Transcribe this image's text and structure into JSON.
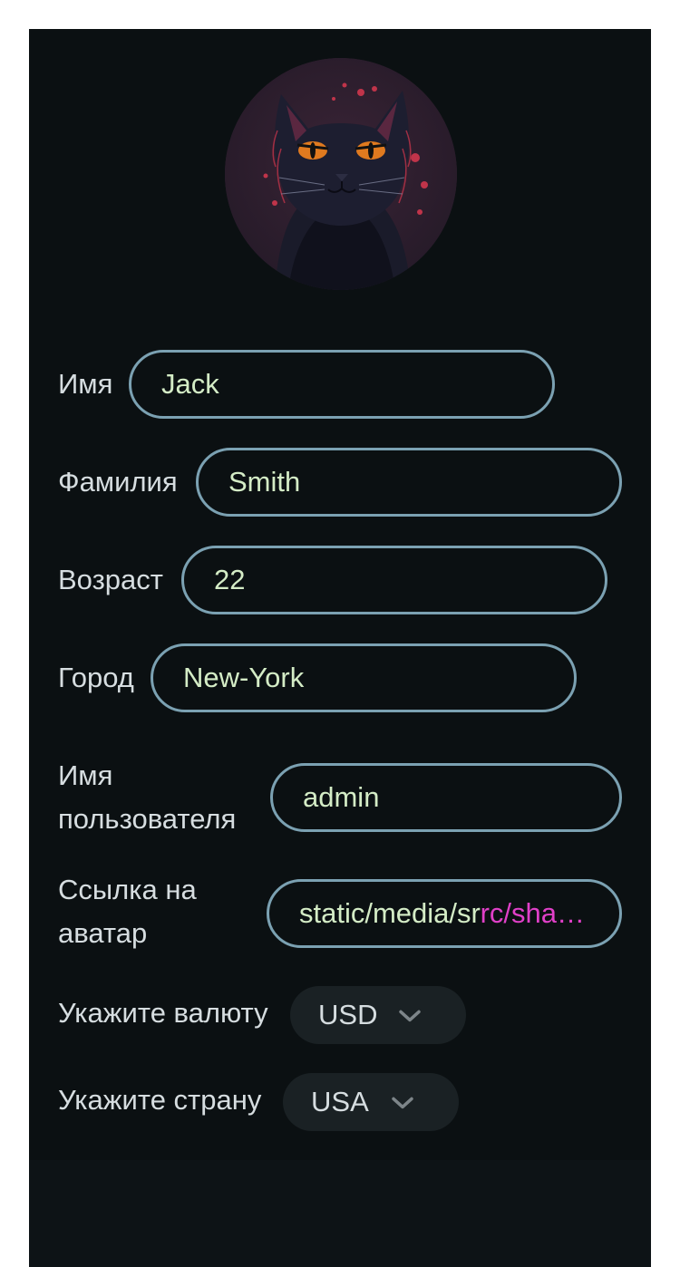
{
  "profile": {
    "avatar_icon": "cat-avatar-icon",
    "fields": {
      "first_name": {
        "label": "Имя",
        "value": "Jack"
      },
      "last_name": {
        "label": "Фамилия",
        "value": "Smith"
      },
      "age": {
        "label": "Возраст",
        "value": "22"
      },
      "city": {
        "label": "Город",
        "value": "New-York"
      },
      "username": {
        "label": "Имя пользователя",
        "value": "admin"
      },
      "avatar_link": {
        "label": "Ссылка на аватар",
        "value": "static/media/src/sha",
        "overflow_text": "rc/sha…"
      }
    },
    "selects": {
      "currency": {
        "label": "Укажите валюту",
        "value": "USD"
      },
      "country": {
        "label": "Укажите страну",
        "value": "USA"
      }
    }
  },
  "colors": {
    "card_background": "#0b1012",
    "input_border": "#7ba1b2",
    "input_text": "#d4ecc6",
    "label_text": "#d6dde0",
    "select_background": "#1a2124"
  }
}
